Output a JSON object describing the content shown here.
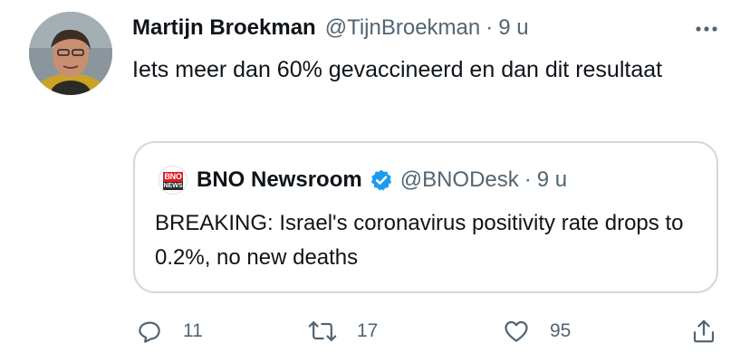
{
  "tweet": {
    "author": {
      "name": "Martijn Broekman",
      "handle": "@TijnBroekman",
      "separator": "·",
      "time": "9 u"
    },
    "text": "Iets meer dan 60% gevaccineerd en dan dit resultaat",
    "more_icon": "more-horizontal-icon"
  },
  "quoted": {
    "logo_top": "BNO",
    "logo_bottom": "NEWS",
    "name": "BNO Newsroom",
    "verified_icon": "verified-badge-icon",
    "handle": "@BNODesk",
    "separator": "·",
    "time": "9 u",
    "text": "BREAKING: Israel's coronavirus positivity rate drops to 0.2%, no new deaths"
  },
  "actions": {
    "reply": {
      "icon": "reply-icon",
      "count": "11"
    },
    "retweet": {
      "icon": "retweet-icon",
      "count": "17"
    },
    "like": {
      "icon": "heart-icon",
      "count": "95"
    },
    "share": {
      "icon": "share-icon"
    }
  },
  "colors": {
    "text": "#0f1419",
    "secondary": "#536471",
    "border": "#cfd9de",
    "verified": "#1d9bf0",
    "brand_red": "#d71f26"
  }
}
